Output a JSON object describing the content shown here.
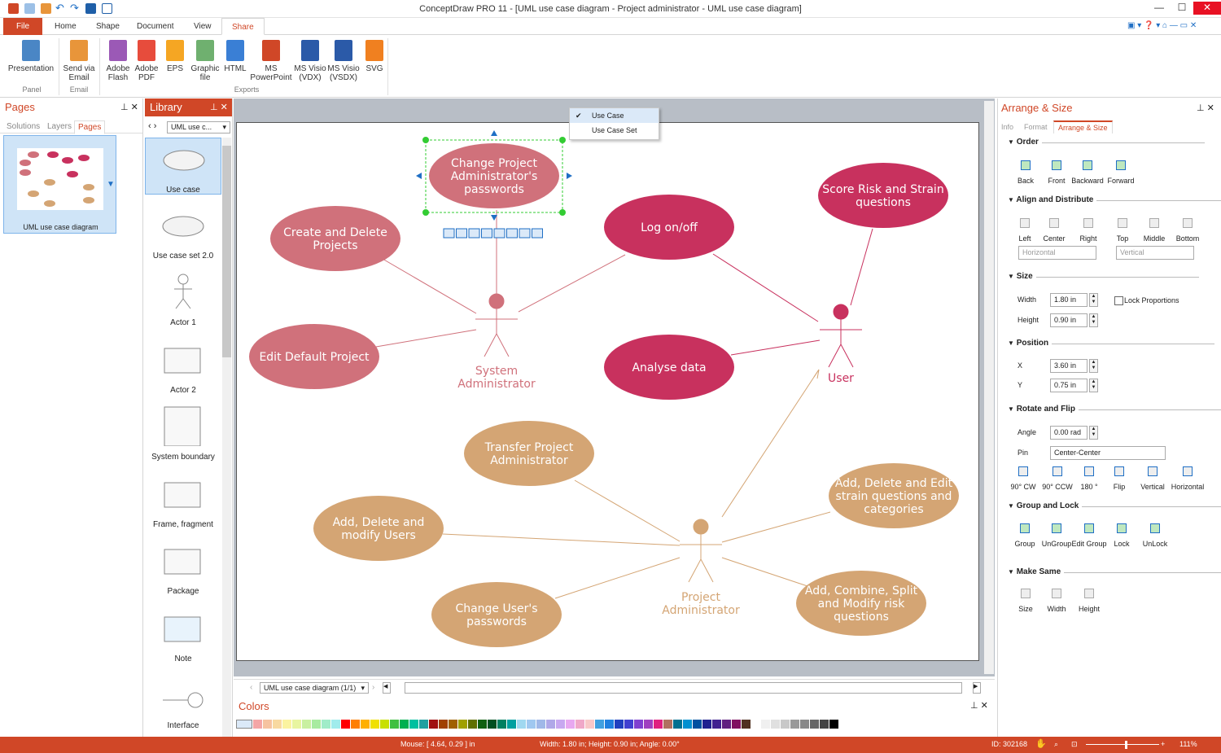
{
  "window": {
    "title": "ConceptDraw PRO 11 - [UML use case diagram - Project administrator - UML use case diagram]"
  },
  "tabs": [
    "File",
    "Home",
    "Shape",
    "Document",
    "View",
    "Share"
  ],
  "ribbon": {
    "buttons": [
      {
        "label": [
          "Presentation"
        ],
        "icon": "presentation-icon",
        "color": "#4a86c5"
      },
      {
        "label": [
          "Send via",
          "Email"
        ],
        "icon": "email-icon",
        "color": "#e8953a"
      },
      {
        "label": [
          "Adobe",
          "Flash"
        ],
        "icon": "SWF",
        "color": "#9b59b6"
      },
      {
        "label": [
          "Adobe",
          "PDF"
        ],
        "icon": "PDF",
        "color": "#e74c3c"
      },
      {
        "label": [
          "EPS"
        ],
        "icon": "EPS",
        "color": "#f5a623"
      },
      {
        "label": [
          "Graphic",
          "file"
        ],
        "icon": "image-icon",
        "color": "#6fb06f"
      },
      {
        "label": [
          "HTML"
        ],
        "icon": "HTML",
        "color": "#3a7fd5"
      },
      {
        "label": [
          "MS",
          "PowerPoint"
        ],
        "icon": "P",
        "color": "#d04727"
      },
      {
        "label": [
          "MS Visio",
          "(VDX)"
        ],
        "icon": "V",
        "color": "#2b5aa8"
      },
      {
        "label": [
          "MS Visio",
          "(VSDX)"
        ],
        "icon": "V",
        "color": "#2b5aa8"
      },
      {
        "label": [
          "SVG"
        ],
        "icon": "SVG",
        "color": "#f08020"
      }
    ],
    "groups": [
      "Panel",
      "Email",
      "Exports"
    ]
  },
  "pages_panel": {
    "title": "Pages",
    "tabs": [
      "Solutions",
      "Layers",
      "Pages"
    ],
    "page_name": "UML use case diagram"
  },
  "library": {
    "title": "Library",
    "selector": "UML use c...",
    "items": [
      "Use case",
      "Use case set 2.0",
      "Actor 1",
      "Actor 2",
      "System boundary",
      "Frame, fragment",
      "Package",
      "Note",
      "Interface"
    ]
  },
  "context_menu": {
    "items": [
      "Use Case",
      "Use Case Set"
    ],
    "checked": 0
  },
  "diagram": {
    "ellipses": [
      {
        "lines": [
          "Change Project",
          "Administrator's",
          "passwords"
        ],
        "color": "#d0717b"
      },
      {
        "lines": [
          "Create and Delete",
          "Projects"
        ],
        "color": "#d0717b"
      },
      {
        "lines": [
          "Edit Default Project"
        ],
        "color": "#d0717b"
      },
      {
        "lines": [
          "Log on/off"
        ],
        "color": "#c8315e"
      },
      {
        "lines": [
          "Score Risk and Strain",
          "questions"
        ],
        "color": "#c8315e"
      },
      {
        "lines": [
          "Analyse data"
        ],
        "color": "#c8315e"
      },
      {
        "lines": [
          "Transfer Project",
          "Administrator"
        ],
        "color": "#d4a574"
      },
      {
        "lines": [
          "Add, Delete and",
          "modify Users"
        ],
        "color": "#d4a574"
      },
      {
        "lines": [
          "Change User's",
          "passwords"
        ],
        "color": "#d4a574"
      },
      {
        "lines": [
          "Add, Delete and Edit",
          "strain questions and",
          "categories"
        ],
        "color": "#d4a574"
      },
      {
        "lines": [
          "Add, Combine, Split",
          "and Modify risk",
          "questions"
        ],
        "color": "#d4a574"
      }
    ],
    "actors": [
      {
        "lines": [
          "System",
          "Administrator"
        ],
        "color": "#d0717b"
      },
      {
        "lines": [
          "User"
        ],
        "color": "#c8315e"
      },
      {
        "lines": [
          "Project",
          "Administrator"
        ],
        "color": "#d4a574"
      }
    ]
  },
  "page_nav": {
    "selector": "UML use case diagram (1/1)"
  },
  "colors_panel": {
    "title": "Colors",
    "swatches": [
      "#f4a6a6",
      "#f6c3a0",
      "#f8d9a0",
      "#fbf3a0",
      "#e8f5a0",
      "#c9f0a0",
      "#a8eba0",
      "#a0ecc8",
      "#a0ecec",
      "#ff0000",
      "#ff7f00",
      "#ffb000",
      "#f0e000",
      "#c8e000",
      "#40c040",
      "#00b050",
      "#00c0a0",
      "#20a0a0",
      "#a01010",
      "#a04000",
      "#a06000",
      "#a0a000",
      "#607000",
      "#106010",
      "#005020",
      "#008060",
      "#00a0a0",
      "#a0d8f0",
      "#a0c8f0",
      "#a0b8e8",
      "#b0a8e8",
      "#c8a8f0",
      "#e8a8f0",
      "#f0a8c8",
      "#f8c8c8",
      "#40a0e0",
      "#2080e0",
      "#2040c0",
      "#4040d0",
      "#8040d0",
      "#a040c0",
      "#e02080",
      "#b07060",
      "#007090",
      "#0090d0",
      "#0050a0",
      "#202090",
      "#402090",
      "#602080",
      "#801060",
      "#503020",
      "#ffffff",
      "#f0f0f0",
      "#e0e0e0",
      "#c8c8c8"
    ]
  },
  "arrange": {
    "title": "Arrange & Size",
    "tabs": [
      "Info",
      "Format",
      "Arrange & Size"
    ],
    "order": {
      "title": "Order",
      "buttons": [
        "Back",
        "Front",
        "Backward",
        "Forward"
      ]
    },
    "align": {
      "title": "Align and Distribute",
      "buttons": [
        "Left",
        "Center",
        "Right",
        "Top",
        "Middle",
        "Bottom"
      ],
      "horizontal": "Horizontal",
      "vertical": "Vertical"
    },
    "size": {
      "title": "Size",
      "width_label": "Width",
      "width": "1.80 in",
      "height_label": "Height",
      "height": "0.90 in",
      "lock": "Lock Proportions"
    },
    "position": {
      "title": "Position",
      "x_label": "X",
      "x": "3.60 in",
      "y_label": "Y",
      "y": "0.75 in"
    },
    "rotate": {
      "title": "Rotate and Flip",
      "angle_label": "Angle",
      "angle": "0.00 rad",
      "pin_label": "Pin",
      "pin": "Center-Center",
      "buttons": [
        "90° CW",
        "90° CCW",
        "180 °",
        "Flip",
        "Vertical",
        "Horizontal"
      ]
    },
    "group": {
      "title": "Group and Lock",
      "buttons": [
        "Group",
        "UnGroup",
        "Edit Group",
        "Lock",
        "UnLock"
      ]
    },
    "same": {
      "title": "Make Same",
      "buttons": [
        "Size",
        "Width",
        "Height"
      ]
    }
  },
  "status": {
    "mouse": "Mouse: [ 4.64, 0.29 ] in",
    "dims": "Width: 1.80 in;  Height: 0.90 in;  Angle: 0.00°",
    "id": "ID: 302168",
    "zoom": "111%"
  }
}
